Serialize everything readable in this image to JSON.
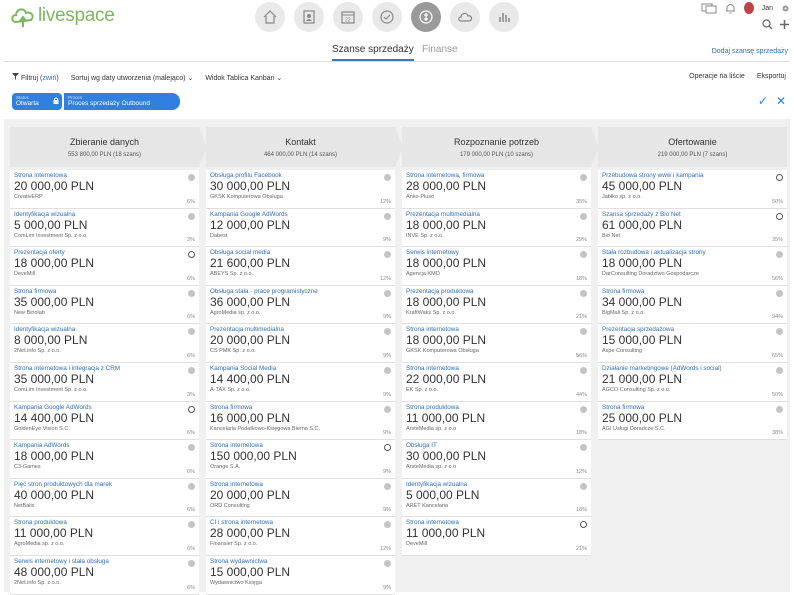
{
  "app": {
    "logo_text": "livespace",
    "user": "Jan"
  },
  "nav": {
    "icons": [
      "home-icon",
      "contacts-icon",
      "calendar-icon",
      "tasks-icon",
      "deals-icon",
      "cloud-icon",
      "reports-icon"
    ],
    "active_index": 4
  },
  "tabs": {
    "active": "Szanse sprzedaży",
    "inactive": "Finanse"
  },
  "add_deal": "Dodaj szansę sprzedaży",
  "toolbar": {
    "filter": "Filtruj",
    "collapse": "zwiń",
    "sort": "Sortuj wg daty utworzenia (malejąco)",
    "view": "Widok Tablica Kanban",
    "operations": "Operacje na liście",
    "export": "Eksportuj"
  },
  "filters": {
    "status_label": "Status",
    "status_value": "Otwarta",
    "process_label": "Proces",
    "process_value": "Proces sprzedaży Outbound"
  },
  "columns": [
    {
      "name": "Zbieranie danych",
      "sum": "553 800,00 PLN",
      "count": "(18 szans)",
      "cards": [
        {
          "title": "Strona internetowa",
          "amount": "20 000,00 PLN",
          "company": "CreativERP",
          "pct": "6%",
          "dot": "filled"
        },
        {
          "title": "Identyfikacja wizualna",
          "amount": "5 000,00 PLN",
          "company": "ComLim Investment Sp. z o.o.",
          "pct": "3%",
          "dot": "filled"
        },
        {
          "title": "Prezentacja oferty",
          "amount": "18 000,00 PLN",
          "company": "DeveMill",
          "pct": "6%",
          "dot": "empty"
        },
        {
          "title": "Strona firmowa",
          "amount": "35 000,00 PLN",
          "company": "New Binolab",
          "pct": "6%",
          "dot": "filled"
        },
        {
          "title": "Identyfikacja wizualna",
          "amount": "8 000,00 PLN",
          "company": "2Net.info Sp. z o.o.",
          "pct": "6%",
          "dot": "filled"
        },
        {
          "title": "Strona internetowa i integracja z CRM",
          "amount": "35 000,00 PLN",
          "company": "ComLim Investment Sp. z o.o.",
          "pct": "3%",
          "dot": "filled"
        },
        {
          "title": "Kampania Google AdWords",
          "amount": "14 400,00 PLN",
          "company": "GoldenEye Vision S.C.",
          "pct": "6%",
          "dot": "empty"
        },
        {
          "title": "Kampania AdWords",
          "amount": "18 000,00 PLN",
          "company": "C3-Games",
          "pct": "6%",
          "dot": "filled"
        },
        {
          "title": "Pięć stron produktowych dla marek",
          "amount": "40 000,00 PLN",
          "company": "NetBalix",
          "pct": "6%",
          "dot": "filled"
        },
        {
          "title": "Strona produktowa",
          "amount": "11 000,00 PLN",
          "company": "AgroMedia sp. z o.o.",
          "pct": "6%",
          "dot": "filled"
        },
        {
          "title": "Serwis internetowy i stała obsługa",
          "amount": "48 000,00 PLN",
          "company": "2Net.info Sp. z o.o.",
          "pct": "6%",
          "dot": "filled"
        }
      ]
    },
    {
      "name": "Kontakt",
      "sum": "464 000,00 PLN",
      "count": "(14 szans)",
      "cards": [
        {
          "title": "Obsługa profilu Facebook",
          "amount": "30 000,00 PLN",
          "company": "GKSK Komputerowa Obsługa",
          "pct": "12%",
          "dot": "filled"
        },
        {
          "title": "Kampania Google AdWords",
          "amount": "12 000,00 PLN",
          "company": "Dabest",
          "pct": "9%",
          "dot": "filled"
        },
        {
          "title": "Obsługa social media",
          "amount": "21 600,00 PLN",
          "company": "ABEYS Sp. z o.o.",
          "pct": "12%",
          "dot": "filled"
        },
        {
          "title": "Obsługa stała - prace programistyczne",
          "amount": "36 000,00 PLN",
          "company": "AgroMedia sp. z o.o.",
          "pct": "9%",
          "dot": "filled"
        },
        {
          "title": "Prezentacja multimedialna",
          "amount": "20 000,00 PLN",
          "company": "CS PMK Sp. z o.o.",
          "pct": "9%",
          "dot": "filled"
        },
        {
          "title": "Kampania Social Media",
          "amount": "14 400,00 PLN",
          "company": "A-TAX Sp. z o.o.",
          "pct": "9%",
          "dot": "filled"
        },
        {
          "title": "Strona firmowa",
          "amount": "16 000,00 PLN",
          "company": "Kancelaria Podatkowo-Księgowa Bierna S.C.",
          "pct": "9%",
          "dot": "filled"
        },
        {
          "title": "Strona internetowa",
          "amount": "150 000,00 PLN",
          "company": "Orange S.A.",
          "pct": "9%",
          "dot": "empty"
        },
        {
          "title": "Strona internetowa",
          "amount": "20 000,00 PLN",
          "company": "ORD Consulting",
          "pct": "9%",
          "dot": "filled"
        },
        {
          "title": "CI i strona internetowa",
          "amount": "28 000,00 PLN",
          "company": "Finansier Sp. z o.o.",
          "pct": "12%",
          "dot": "filled"
        },
        {
          "title": "Strona wydawnictwa",
          "amount": "15 000,00 PLN",
          "company": "Wydawnictwo Księga",
          "pct": "9%",
          "dot": "filled"
        }
      ]
    },
    {
      "name": "Rozpoznanie potrzeb",
      "sum": "179 000,00 PLN",
      "count": "(10 szans)",
      "cards": [
        {
          "title": "Strona internetowa, firmowa",
          "amount": "28 000,00 PLN",
          "company": "Anko-Pluso",
          "pct": "35%",
          "dot": "filled"
        },
        {
          "title": "Prezentacja multimedialna",
          "amount": "18 000,00 PLN",
          "company": "INVE Sp. z o.o.",
          "pct": "29%",
          "dot": "filled"
        },
        {
          "title": "Serwis internetowy",
          "amount": "18 000,00 PLN",
          "company": "Agencja KMO",
          "pct": "18%",
          "dot": "filled"
        },
        {
          "title": "Prezentacja produktowa",
          "amount": "18 000,00 PLN",
          "company": "KraftWaks Sp. z o.o.",
          "pct": "21%",
          "dot": "filled"
        },
        {
          "title": "Strona internetowa",
          "amount": "18 000,00 PLN",
          "company": "GKSK Komputerowa Obsługa",
          "pct": "56%",
          "dot": "filled"
        },
        {
          "title": "Strona internetowa",
          "amount": "22 000,00 PLN",
          "company": "EK Sp. z o.o.",
          "pct": "44%",
          "dot": "filled"
        },
        {
          "title": "Strona produktowa",
          "amount": "11 000,00 PLN",
          "company": "ArsteMedia sp. z o.o",
          "pct": "18%",
          "dot": "filled"
        },
        {
          "title": "Obsługa IT",
          "amount": "30 000,00 PLN",
          "company": "ArsteMedia sp. z o.o",
          "pct": "12%",
          "dot": "filled"
        },
        {
          "title": "Identyfikacja wizualna",
          "amount": "5 000,00 PLN",
          "company": "ARET Kancelaria",
          "pct": "18%",
          "dot": "filled"
        },
        {
          "title": "Strona internetowa",
          "amount": "11 000,00 PLN",
          "company": "DeveMill",
          "pct": "21%",
          "dot": "empty"
        }
      ]
    },
    {
      "name": "Ofertowanie",
      "sum": "219 000,00 PLN",
      "count": "(7 szans)",
      "cards": [
        {
          "title": "Przebudowa strony www i kampania",
          "amount": "45 000,00 PLN",
          "company": "Jabłko sp. z o.o.",
          "pct": "50%",
          "dot": "empty"
        },
        {
          "title": "Szansa sprzedaży z Bio Net",
          "amount": "61 000,00 PLN",
          "company": "Bio Net",
          "pct": "35%",
          "dot": "empty"
        },
        {
          "title": "Stała rozbudowa i aktualizacja strony",
          "amount": "18 000,00 PLN",
          "company": "DarConsulting Doradztwo Gospodarcze",
          "pct": "56%",
          "dot": "filled"
        },
        {
          "title": "Strona firmowa",
          "amount": "34 000,00 PLN",
          "company": "BigMali Sp. z o.o.",
          "pct": "94%",
          "dot": "filled"
        },
        {
          "title": "Prezentacja sprzedażowa",
          "amount": "15 000,00 PLN",
          "company": "Aspe Consulting",
          "pct": "65%",
          "dot": "filled"
        },
        {
          "title": "Działanie marketingowe (AdWords i social)",
          "amount": "21 000,00 PLN",
          "company": "AGCO Consulting Sp. z o.o.",
          "pct": "50%",
          "dot": "filled"
        },
        {
          "title": "Strona firmowa",
          "amount": "25 000,00 PLN",
          "company": "AGI Usługi Doradcze S.C.",
          "pct": "38%",
          "dot": "filled"
        }
      ]
    }
  ]
}
